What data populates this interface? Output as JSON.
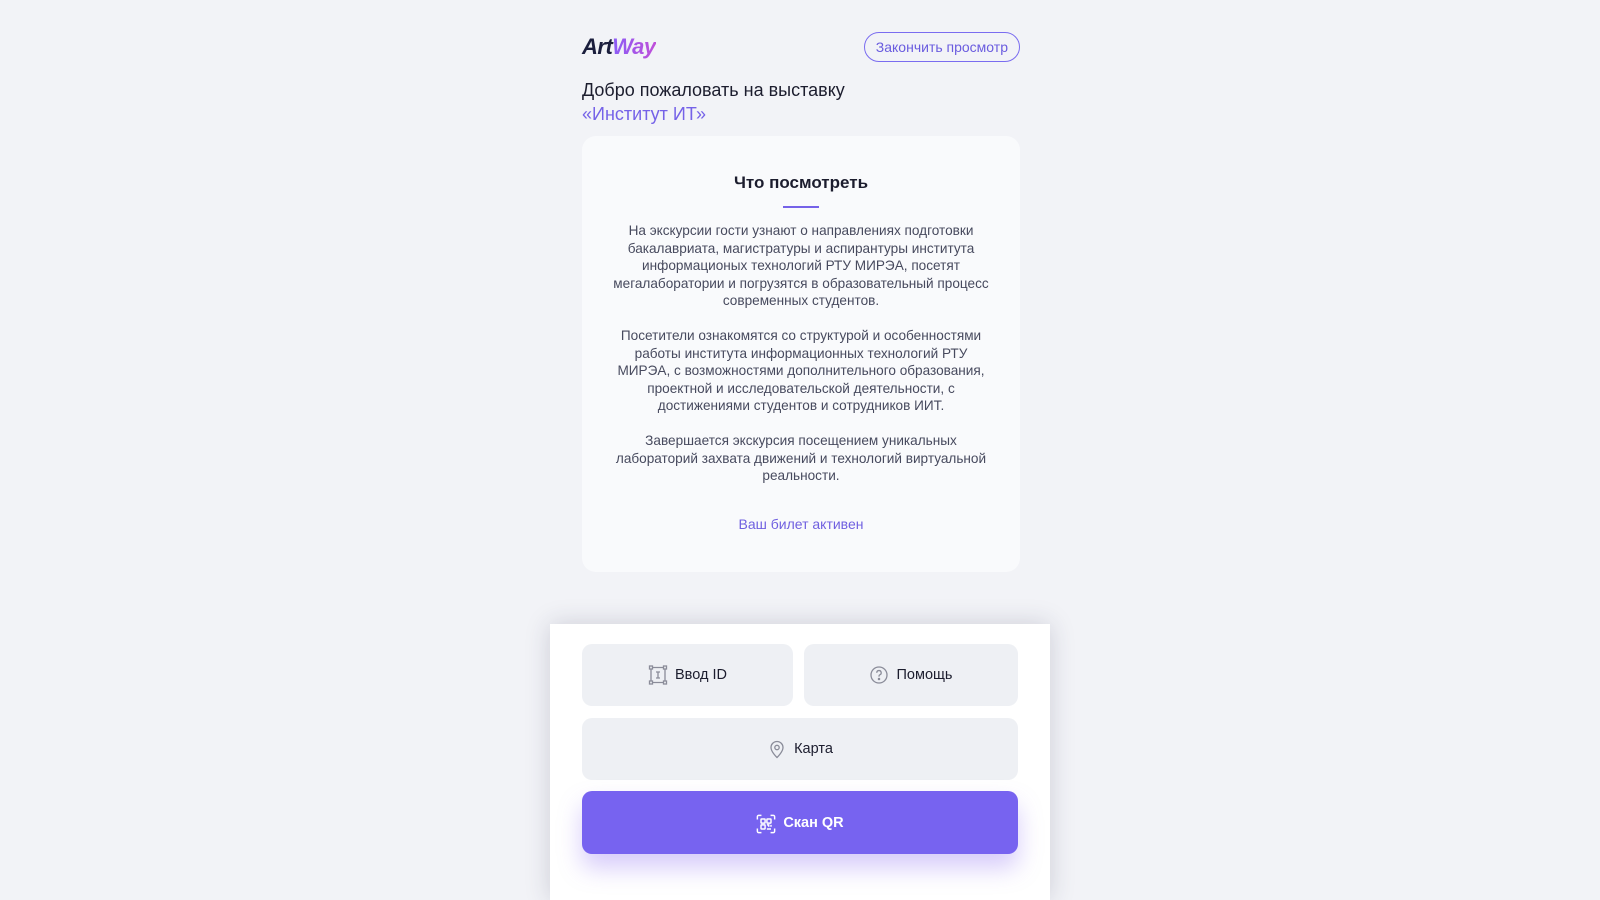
{
  "brand": {
    "logo_part1": "Art",
    "logo_part2": "Way",
    "accent_color": "#7562e8"
  },
  "header": {
    "end_view_label": "Закончить просмотр"
  },
  "welcome": {
    "line1": "Добро пожаловать на выставку",
    "exhibition_name": "«Институт ИТ»"
  },
  "card": {
    "title": "Что посмотреть",
    "paragraphs": [
      "На экскурсии гости узнают о направлениях подготовки бакалавриата, магистратуры и аспирантуры института информационых технологий РТУ МИРЭА, посетят мегалаборатории и погрузятся в образовательный процесс современных студентов.",
      "Посетители ознакомятся со структурой и особенностями работы института информационных технологий РТУ МИРЭА, с возможностями дополнительного образования, проектной и исследовательской деятельности, с достижениями студентов и сотрудников ИИТ.",
      "Завершается экскурсия посещением уникальных лабораторий захвата движений и технологий виртуальной реальности."
    ],
    "ticket_status": "Ваш билет активен"
  },
  "actions": {
    "enter_id": {
      "label": "Ввод ID",
      "icon": "id-frame-icon"
    },
    "help": {
      "label": "Помощь",
      "icon": "question-circle-icon"
    },
    "map": {
      "label": "Карта",
      "icon": "map-pin-icon"
    },
    "scan_qr": {
      "label": "Скан QR",
      "icon": "qr-scan-icon",
      "color": "#7763f0"
    }
  }
}
